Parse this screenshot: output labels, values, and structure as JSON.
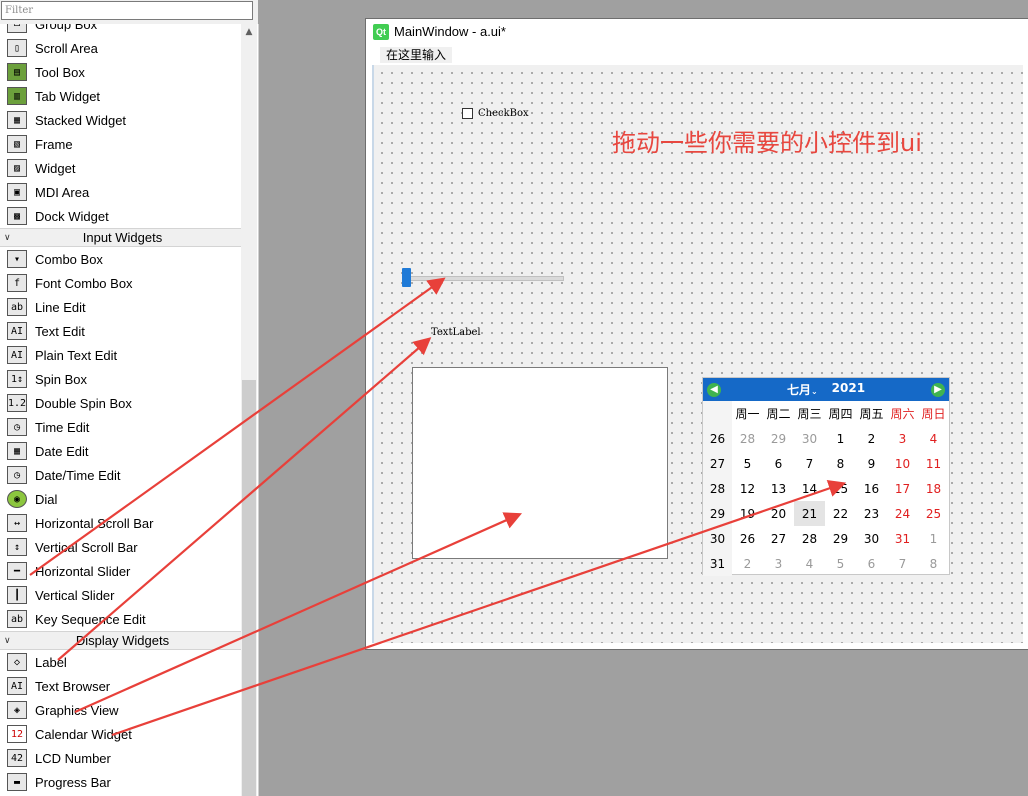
{
  "filter": {
    "placeholder": "Filter"
  },
  "widget_box": {
    "items_top": [
      {
        "label": "Group Box",
        "icon": "group-box-icon"
      },
      {
        "label": "Scroll Area",
        "icon": "scroll-area-icon"
      },
      {
        "label": "Tool Box",
        "icon": "tool-box-icon"
      },
      {
        "label": "Tab Widget",
        "icon": "tab-widget-icon"
      },
      {
        "label": "Stacked Widget",
        "icon": "stacked-widget-icon"
      },
      {
        "label": "Frame",
        "icon": "frame-icon"
      },
      {
        "label": "Widget",
        "icon": "widget-icon"
      },
      {
        "label": "MDI Area",
        "icon": "mdi-area-icon"
      },
      {
        "label": "Dock Widget",
        "icon": "dock-widget-icon"
      }
    ],
    "input_category": "Input Widgets",
    "input_items": [
      {
        "label": "Combo Box",
        "icon": "combo-box-icon"
      },
      {
        "label": "Font Combo Box",
        "icon": "font-combo-box-icon"
      },
      {
        "label": "Line Edit",
        "icon": "line-edit-icon"
      },
      {
        "label": "Text Edit",
        "icon": "text-edit-icon"
      },
      {
        "label": "Plain Text Edit",
        "icon": "plain-text-edit-icon"
      },
      {
        "label": "Spin Box",
        "icon": "spin-box-icon"
      },
      {
        "label": "Double Spin Box",
        "icon": "double-spin-box-icon"
      },
      {
        "label": "Time Edit",
        "icon": "time-edit-icon"
      },
      {
        "label": "Date Edit",
        "icon": "date-edit-icon"
      },
      {
        "label": "Date/Time Edit",
        "icon": "date-time-edit-icon"
      },
      {
        "label": "Dial",
        "icon": "dial-icon"
      },
      {
        "label": "Horizontal Scroll Bar",
        "icon": "horizontal-scroll-bar-icon"
      },
      {
        "label": "Vertical Scroll Bar",
        "icon": "vertical-scroll-bar-icon"
      },
      {
        "label": "Horizontal Slider",
        "icon": "horizontal-slider-icon"
      },
      {
        "label": "Vertical Slider",
        "icon": "vertical-slider-icon"
      },
      {
        "label": "Key Sequence Edit",
        "icon": "key-sequence-edit-icon"
      }
    ],
    "display_category": "Display Widgets",
    "display_items": [
      {
        "label": "Label",
        "icon": "label-icon"
      },
      {
        "label": "Text Browser",
        "icon": "text-browser-icon"
      },
      {
        "label": "Graphics View",
        "icon": "graphics-view-icon"
      },
      {
        "label": "Calendar Widget",
        "icon": "calendar-widget-icon"
      },
      {
        "label": "LCD Number",
        "icon": "lcd-number-icon"
      },
      {
        "label": "Progress Bar",
        "icon": "progress-bar-icon"
      }
    ]
  },
  "window": {
    "logo": "Qt",
    "title": "MainWindow - a.ui*",
    "menu_placeholder": "在这里输入"
  },
  "form": {
    "checkbox_label": "CheckBox",
    "text_label": "TextLabel",
    "annotation": "拖动一些你需要的小控件到ui",
    "annotation_color": "#e8473f"
  },
  "calendar": {
    "month": "七月",
    "year": "2021",
    "weekdays": [
      "周一",
      "周二",
      "周三",
      "周四",
      "周五",
      "周六",
      "周日"
    ],
    "weeks": [
      {
        "week": "26",
        "days": [
          "28",
          "29",
          "30",
          "1",
          "2",
          "3",
          "4"
        ]
      },
      {
        "week": "27",
        "days": [
          "5",
          "6",
          "7",
          "8",
          "9",
          "10",
          "11"
        ]
      },
      {
        "week": "28",
        "days": [
          "12",
          "13",
          "14",
          "15",
          "16",
          "17",
          "18"
        ]
      },
      {
        "week": "29",
        "days": [
          "19",
          "20",
          "21",
          "22",
          "23",
          "24",
          "25"
        ]
      },
      {
        "week": "30",
        "days": [
          "26",
          "27",
          "28",
          "29",
          "30",
          "31",
          "1"
        ]
      },
      {
        "week": "31",
        "days": [
          "2",
          "3",
          "4",
          "5",
          "6",
          "7",
          "8"
        ]
      }
    ],
    "other_month_cells": [
      [
        0,
        0
      ],
      [
        0,
        1
      ],
      [
        0,
        2
      ],
      [
        4,
        6
      ],
      [
        5,
        0
      ],
      [
        5,
        1
      ],
      [
        5,
        2
      ],
      [
        5,
        3
      ],
      [
        5,
        4
      ],
      [
        5,
        5
      ],
      [
        5,
        6
      ]
    ],
    "selected_cell": [
      3,
      2
    ],
    "header_color": "#1569c7",
    "weekend_color": "#e02020"
  },
  "arrow_color": "#e8403a"
}
